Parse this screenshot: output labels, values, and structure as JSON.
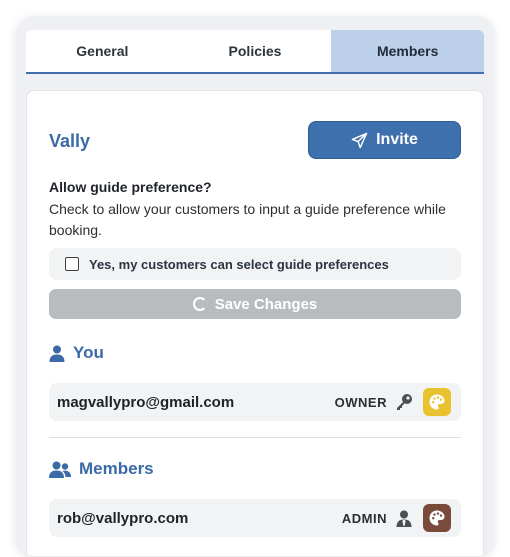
{
  "tabs": [
    {
      "label": "General",
      "active": false
    },
    {
      "label": "Policies",
      "active": false
    },
    {
      "label": "Members",
      "active": true
    }
  ],
  "team": {
    "name": "Vally",
    "invite_label": "Invite"
  },
  "preference": {
    "title": "Allow guide preference?",
    "description": "Check to allow your customers to input a guide preference while booking.",
    "checkbox_label": "Yes, my customers can select guide preferences",
    "checked": false,
    "save_label": "Save Changes"
  },
  "you_section": {
    "heading": "You",
    "email": "magvallypro@gmail.com",
    "role": "OWNER",
    "role_icon": "key-icon",
    "palette_color": "#e9c230"
  },
  "members_section": {
    "heading": "Members",
    "members": [
      {
        "email": "rob@vallypro.com",
        "role": "ADMIN",
        "role_icon": "user-tie-icon",
        "palette_color": "#7a4a3a"
      }
    ]
  },
  "colors": {
    "accent": "#3e70ae",
    "active_tab": "#bdd0ea",
    "disabled": "#b9bcbf"
  }
}
